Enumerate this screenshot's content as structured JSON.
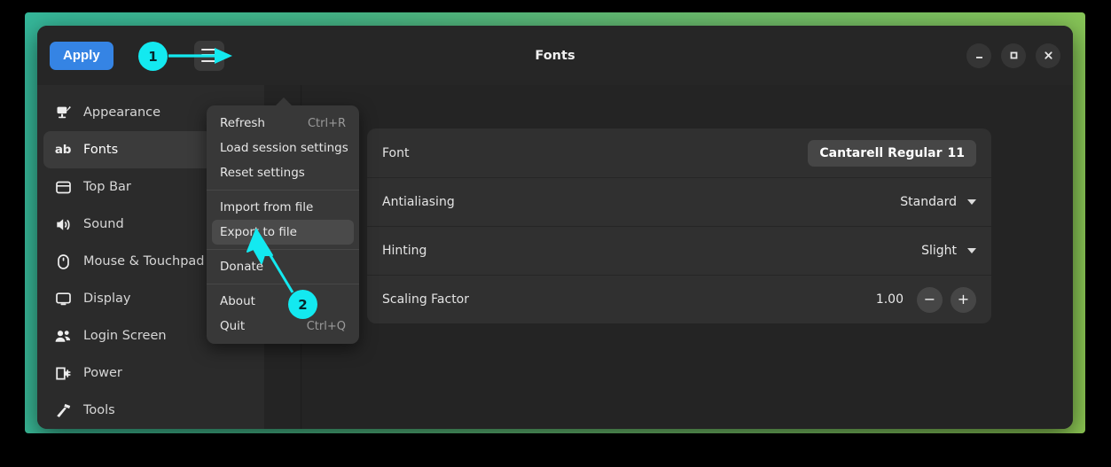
{
  "desktop": {
    "gradient_from": "#35b79a",
    "gradient_to": "#8cc653"
  },
  "window": {
    "title": "Fonts",
    "accent_color": "#3584e4",
    "surface_color": "#242424",
    "header": {
      "apply_label": "Apply",
      "menu_button": "hamburger-menu",
      "controls": [
        {
          "name": "minimize",
          "glyph": "–"
        },
        {
          "name": "maximize",
          "glyph": "□"
        },
        {
          "name": "close",
          "glyph": "✕"
        }
      ]
    }
  },
  "sidebar": {
    "items": [
      {
        "label": "Appearance",
        "icon": "appearance-icon",
        "active": false
      },
      {
        "label": "Fonts",
        "icon": "fonts-ab-icon",
        "active": true
      },
      {
        "label": "Top Bar",
        "icon": "topbar-icon",
        "active": false
      },
      {
        "label": "Sound",
        "icon": "sound-icon",
        "active": false
      },
      {
        "label": "Mouse & Touchpad",
        "icon": "mouse-icon",
        "active": false
      },
      {
        "label": "Display",
        "icon": "display-icon",
        "active": false
      },
      {
        "label": "Login Screen",
        "icon": "users-icon",
        "active": false
      },
      {
        "label": "Power",
        "icon": "power-plug-icon",
        "active": false
      },
      {
        "label": "Tools",
        "icon": "hammer-icon",
        "active": false
      }
    ]
  },
  "menu": {
    "visible": true,
    "items": [
      {
        "label": "Refresh",
        "accel": "Ctrl+R",
        "selected": false,
        "separator_after": false
      },
      {
        "label": "Load session settings",
        "accel": "",
        "selected": false,
        "separator_after": false
      },
      {
        "label": "Reset settings",
        "accel": "",
        "selected": false,
        "separator_after": true
      },
      {
        "label": "Import from file",
        "accel": "",
        "selected": false,
        "separator_after": false
      },
      {
        "label": "Export to file",
        "accel": "",
        "selected": true,
        "separator_after": true
      },
      {
        "label": "Donate",
        "accel": "",
        "selected": false,
        "separator_after": true
      },
      {
        "label": "About",
        "accel": "",
        "selected": false,
        "separator_after": false
      },
      {
        "label": "Quit",
        "accel": "Ctrl+Q",
        "selected": false,
        "separator_after": false
      }
    ]
  },
  "preferences": {
    "rows": [
      {
        "label": "Font",
        "control": "font-button",
        "value": "Cantarell Regular",
        "size": "11"
      },
      {
        "label": "Antialiasing",
        "control": "dropdown",
        "value": "Standard"
      },
      {
        "label": "Hinting",
        "control": "dropdown",
        "value": "Slight"
      },
      {
        "label": "Scaling Factor",
        "control": "spinner",
        "value": "1.00",
        "minus": "−",
        "plus": "+"
      }
    ]
  },
  "annotations": {
    "color": "#13e9f0",
    "steps": [
      {
        "number": "1",
        "target": "hamburger-menu-button",
        "marker": "arrow"
      },
      {
        "number": "2",
        "target": "export-to-file-menu-item",
        "marker": "cursor"
      }
    ]
  }
}
